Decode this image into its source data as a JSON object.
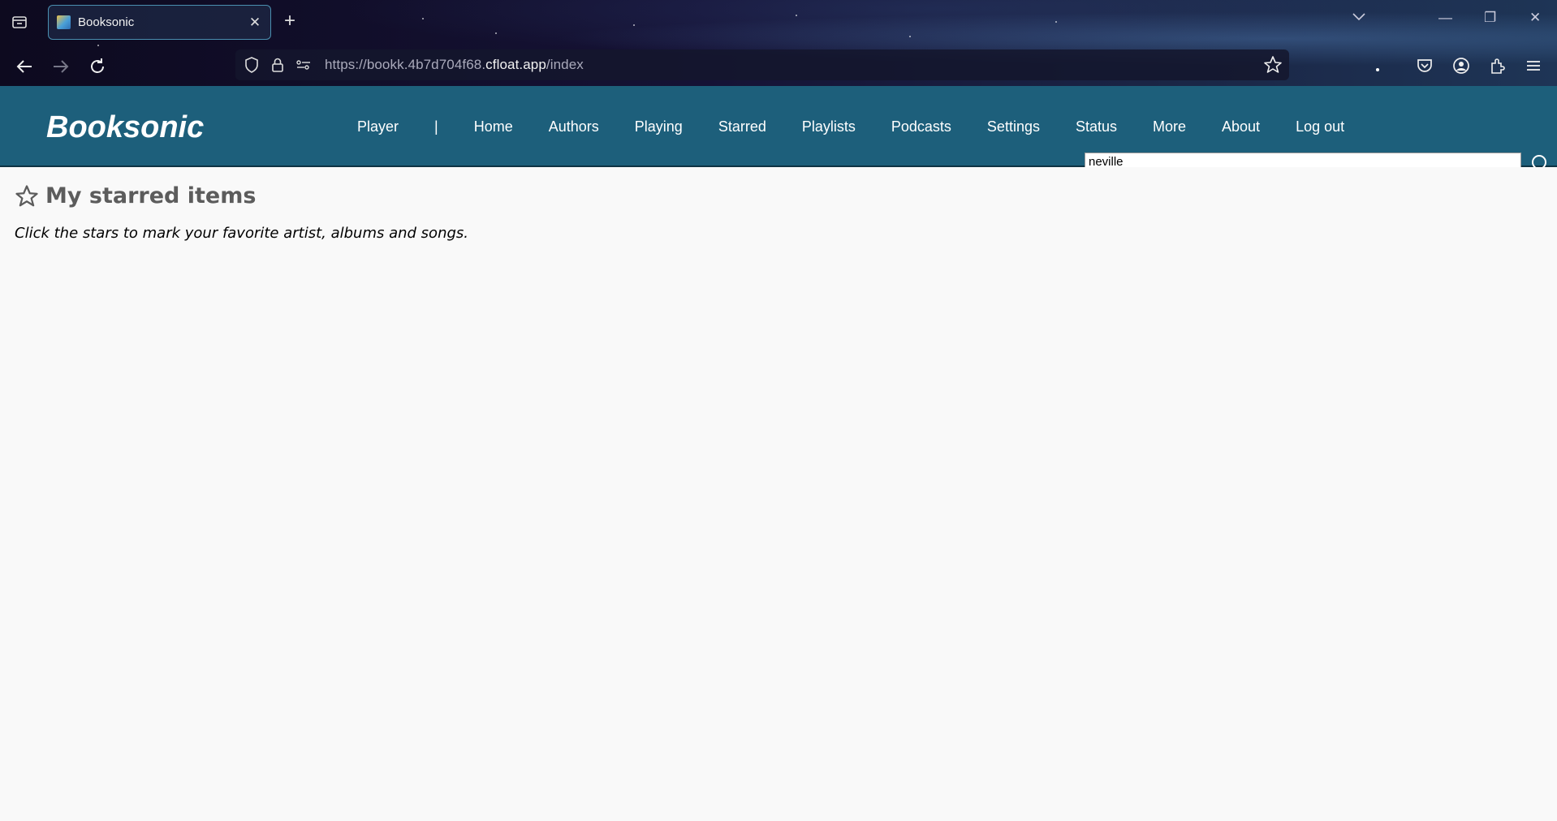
{
  "browser": {
    "tab_title": "Booksonic",
    "url_prefix": "https://bookk.4b7d704f68.",
    "url_host": "cfloat.app",
    "url_path": "/index"
  },
  "app": {
    "logo": "Booksonic",
    "menu": [
      "Player",
      "|",
      "Home",
      "Authors",
      "Playing",
      "Starred",
      "Playlists",
      "Podcasts",
      "Settings",
      "Status",
      "More",
      "About",
      "Log out"
    ],
    "search_value": "neville"
  },
  "main": {
    "title": "My starred items",
    "hint": "Click the stars to mark your favorite artist, albums and songs."
  },
  "colors": {
    "header_bg": "#1d5f7b",
    "page_bg": "#f9f9f9",
    "title_color": "#5c5c5c"
  }
}
